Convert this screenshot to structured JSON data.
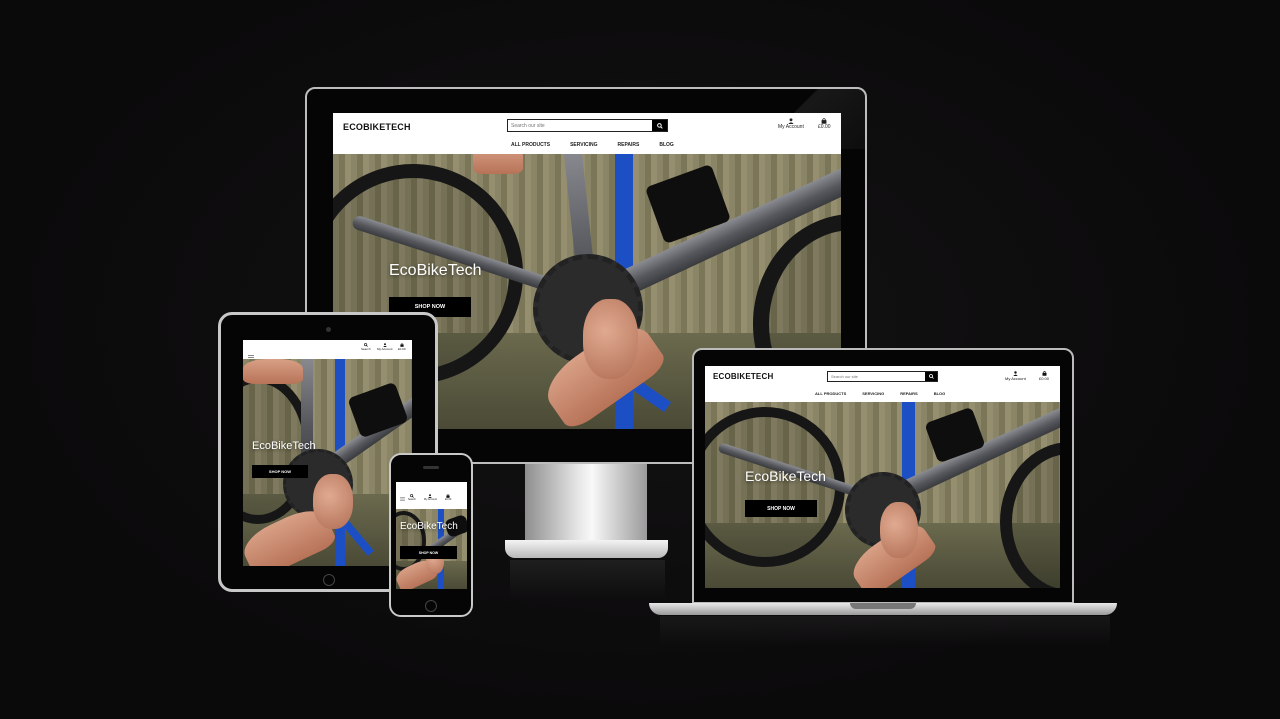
{
  "site": {
    "logo": "ECOBIKETECH",
    "search_placeholder": "Search our site",
    "account_label": "My Account",
    "search_label": "Search",
    "cart_total": "£0.00",
    "nav": [
      "ALL PRODUCTS",
      "SERVICING",
      "REPAIRS",
      "BLOG"
    ],
    "hero_title": "EcoBikeTech",
    "shop_button": "SHOP NOW"
  },
  "icons": {
    "search": "search-icon",
    "account": "user-icon",
    "cart": "shopping-bag-icon",
    "menu": "hamburger-menu-icon"
  },
  "colors": {
    "background": "#0c0b0c",
    "header_bg": "#ffffff",
    "button_bg": "#000000",
    "hero_title": "#ffffff",
    "stand_blue": "#1d4fc4"
  }
}
